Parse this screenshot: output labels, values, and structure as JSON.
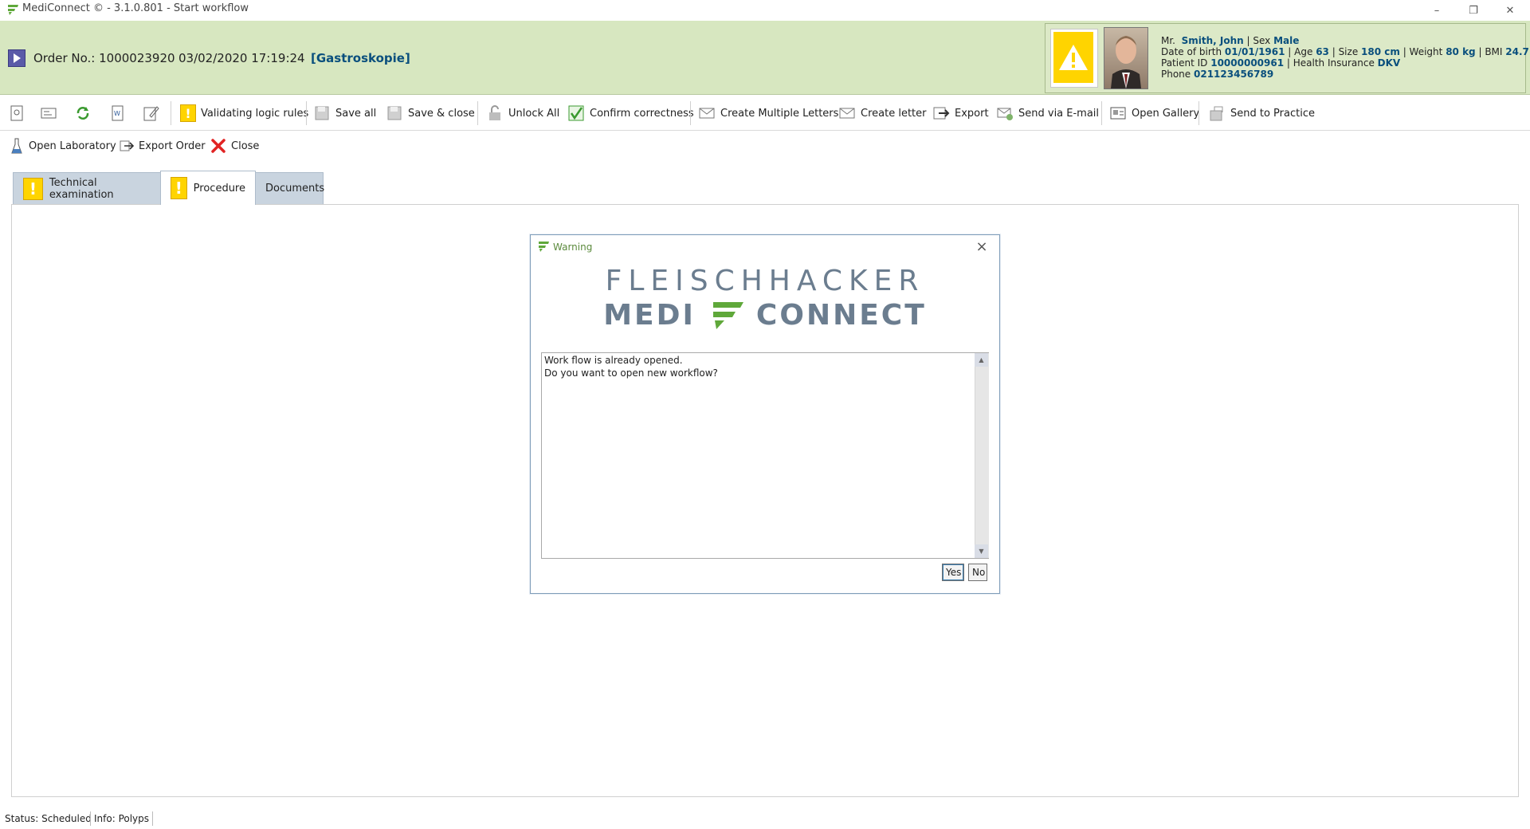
{
  "window": {
    "title": "MediConnect © - 3.1.0.801 - Start workflow",
    "minimize": "–",
    "restore": "❐",
    "close": "✕"
  },
  "order": {
    "label": "Order No.: 1000023920",
    "datetime": "03/02/2020 17:19:24",
    "procedure": "[Gastroskopie]"
  },
  "patient": {
    "title": "Mr.",
    "name": "Smith, John",
    "sex_label": "Sex",
    "sex": "Male",
    "dob_label": "Date of birth",
    "dob": "01/01/1961",
    "age_label": "Age",
    "age": "63",
    "size_label": "Size",
    "size": "180 cm",
    "weight_label": "Weight",
    "weight": "80 kg",
    "bmi_label": "BMI",
    "bmi": "24.7",
    "patient_id_label": "Patient ID",
    "patient_id": "10000000961",
    "insurance_label": "Health Insurance",
    "insurance": "DKV",
    "phone_label": "Phone",
    "phone": "021123456789"
  },
  "toolbar": {
    "validating": "Validating logic rules",
    "save_all": "Save all",
    "save_close": "Save & close",
    "unlock_all": "Unlock All",
    "confirm": "Confirm correctness",
    "create_multiple": "Create Multiple Letters",
    "create_letter": "Create letter",
    "export": "Export",
    "send_email": "Send via E-mail",
    "open_gallery": "Open Gallery",
    "send_practice": "Send to Practice"
  },
  "toolbar2": {
    "open_lab": "Open Laboratory",
    "export_order": "Export Order",
    "close": "Close"
  },
  "tabs": [
    {
      "label": "Technical examination"
    },
    {
      "label": "Procedure"
    },
    {
      "label": "Documents"
    }
  ],
  "dialog": {
    "title": "Warning",
    "brand_line1": "FLEISCHHACKER",
    "brand_word1": "MEDI",
    "brand_word2": "CONNECT",
    "message": "Work flow is already opened.\nDo you want to open new workflow?",
    "yes": "Yes",
    "no": "No"
  },
  "status": {
    "status": "Status: Scheduled",
    "info": "Info: Polyps"
  },
  "colors": {
    "header_bg": "#d7e7c0",
    "accent_blue": "#0a4f7d",
    "warning_yellow": "#ffd400",
    "brand_gray": "#6b7d8f",
    "brand_green": "#5fa83a"
  }
}
